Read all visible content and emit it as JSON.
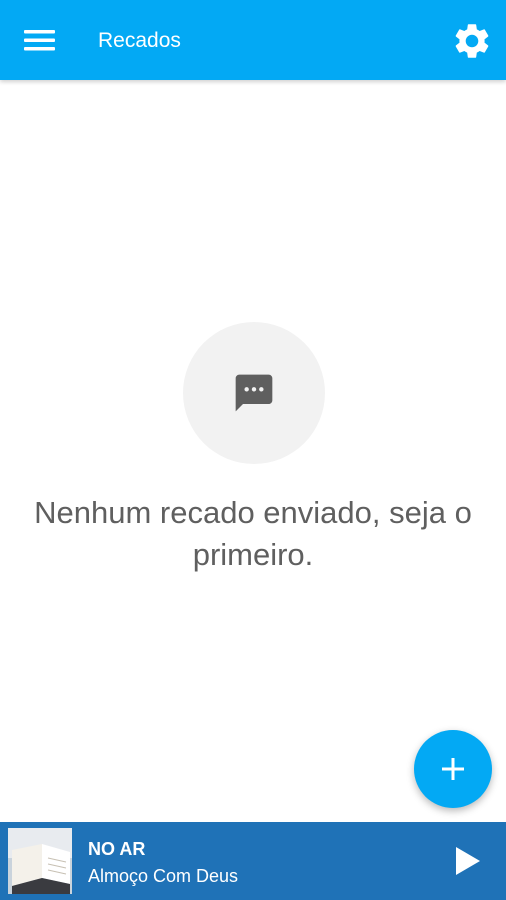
{
  "app": {
    "title": "Recados",
    "accent_color": "#03a9f4",
    "player_color": "#1f72b7"
  },
  "header": {
    "menu_icon": "hamburger-menu-icon",
    "settings_icon": "gear-icon"
  },
  "empty_state": {
    "icon": "chat-bubble-icon",
    "message": "Nenhum recado enviado, seja o primeiro."
  },
  "fab": {
    "icon": "plus-icon"
  },
  "player": {
    "status": "NO AR",
    "program": "Almoço Com Deus",
    "thumbnail": "open-book-image",
    "play_icon": "play-icon"
  }
}
